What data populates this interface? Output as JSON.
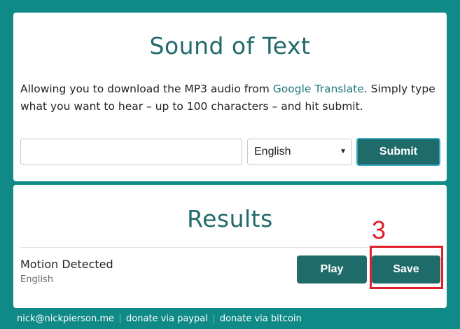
{
  "header": {
    "title": "Sound of Text",
    "description_before": "Allowing you to download the MP3 audio from ",
    "description_link": "Google Translate",
    "description_after": ". Simply type what you want to hear – up to 100 characters – and hit submit."
  },
  "form": {
    "text_value": "",
    "text_placeholder": "",
    "language_selected": "English",
    "submit_label": "Submit"
  },
  "results": {
    "title": "Results",
    "items": [
      {
        "name": "Motion Detected",
        "language": "English",
        "play_label": "Play",
        "save_label": "Save"
      }
    ]
  },
  "annotation": {
    "label": "3",
    "color": "#e0202a"
  },
  "footer": {
    "links": [
      "nick@nickpierson.me",
      "donate via paypal",
      "donate via bitcoin"
    ]
  },
  "colors": {
    "background": "#0f8a87",
    "accent": "#1f6b69",
    "title": "#226a6b"
  }
}
